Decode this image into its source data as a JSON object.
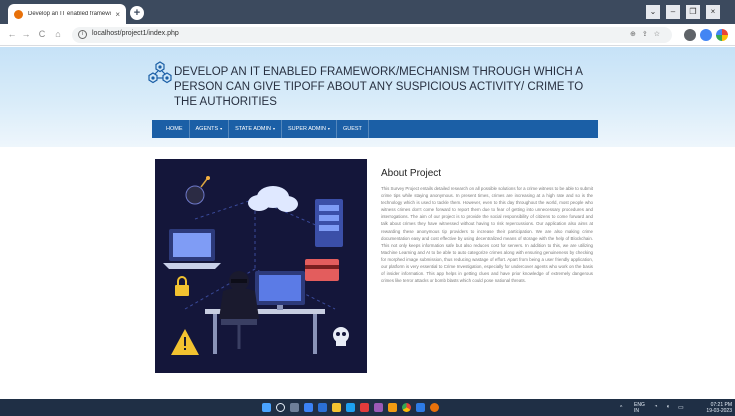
{
  "browser": {
    "tab_title": "Develop an IT enabled framewo",
    "tab_close": "×",
    "new_tab": "+",
    "url": "localhost/project1/index.php",
    "nav": {
      "back": "←",
      "forward": "→",
      "reload": "C",
      "home": "⌂"
    },
    "window_controls": [
      "⌄",
      "–",
      "❐",
      "×"
    ]
  },
  "header": {
    "headline": "DEVELOP AN IT ENABLED FRAMEWORK/MECHANISM THROUGH WHICH A PERSON CAN GIVE TIPOFF ABOUT ANY SUSPICIOUS ACTIVITY/ CRIME TO THE AUTHORITIES"
  },
  "menu": {
    "items": [
      {
        "label": "HOME",
        "dropdown": false
      },
      {
        "label": "AGENTS",
        "dropdown": true
      },
      {
        "label": "STATE ADMIN",
        "dropdown": true
      },
      {
        "label": "SUPER ADMIN",
        "dropdown": true
      },
      {
        "label": "GUEST",
        "dropdown": false
      }
    ],
    "caret": "▾"
  },
  "about": {
    "title": "About Project",
    "body": "This Survey Project entails detailed research on all possible solutions for a crime witness to be able to submit crime tips while staying anonymous. In present times, crimes are increasing at a high rate and so is the technology which is used to tackle them. However, even to this day throughout the world, most people who witness crimes don’t come forward to report them due to fear of getting into unnecessary procedures and interrogations. The aim of our project is to provide the social responsibility of citizens to come forward and talk about crimes they have witnessed without having to risk repercussions. Our application also aims at rewarding these anonymous tip providers to increase their participation. We are also making crime documentation easy and cost effective by using decentralized means of storage with the help of Blockchain. This not only keeps information safe but also reduces cost for servers. In addition to this, we are utilizing Machine Learning and AI to be able to auto categorize crimes along with ensuring genuineness by checking for morphed image submission, thus reducing wastage of effort. Apart from being a user friendly application, our platform is very essential to Crime Investigation, especially for undercover agents who work on the basis of insider information. This app helps in getting clues and have prior knowledge of extremely dangerous crimes like terror attacks or bomb blasts which could pose national threats."
  },
  "taskbar": {
    "lang": "ENG",
    "region": "IN",
    "time": "07:21 PM",
    "date": "19-03-2023"
  },
  "colors": {
    "menu_blue": "#1b5fa6",
    "hero_top": "#c6e2f7",
    "illustration_bg": "#14163a",
    "tab_bar": "#3c4a5e",
    "taskbar": "#1f2f45"
  }
}
